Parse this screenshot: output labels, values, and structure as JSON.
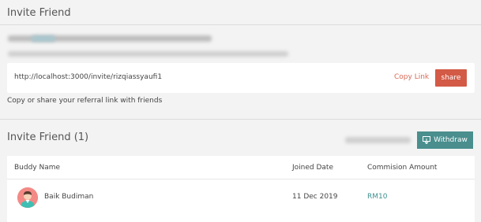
{
  "invite": {
    "title": "Invite Friend",
    "link": "http://localhost:3000/invite/rizqiassyaufi1",
    "copy_label": "Copy Link",
    "share_label": "share",
    "helper": "Copy or share your referral link with friends"
  },
  "friends": {
    "title": "Invite Friend (1)",
    "withdraw_label": "Withdraw",
    "columns": [
      "Buddy Name",
      "Joined Date",
      "Commision Amount"
    ],
    "rows": [
      {
        "name": "Baik Budiman",
        "joined": "11 Dec 2019",
        "amount": "RM10"
      }
    ]
  },
  "colors": {
    "accent_red": "#d35a46",
    "accent_teal": "#4a8e8e",
    "amount_teal": "#3f8f8f"
  },
  "icons": {
    "withdraw": "withdraw-icon",
    "avatar": "user-avatar"
  }
}
